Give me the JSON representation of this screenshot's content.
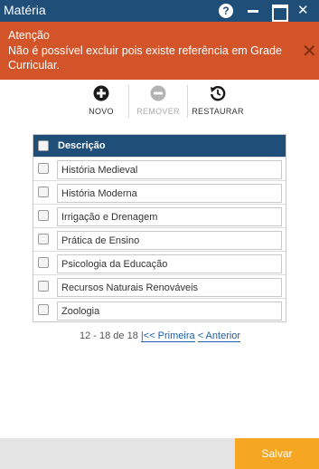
{
  "window": {
    "title": "Matéria"
  },
  "alert": {
    "heading": "Atenção",
    "message": "Não é possível excluir pois existe referência em Grade Curricular.",
    "close": "✕"
  },
  "toolbar": {
    "new_label": "NOVO",
    "remove_label": "REMOVER",
    "restore_label": "RESTAURAR"
  },
  "table": {
    "header": "Descrição",
    "rows": [
      "História Medieval",
      "História Moderna",
      "Irrigação e Drenagem",
      "Prática de Ensino",
      "Psicologia da Educação",
      "Recursos Naturais Renováveis",
      "Zoologia"
    ]
  },
  "pager": {
    "range": "12 - 18 de 18",
    "first": "|<< Primeira",
    "previous": "< Anterior"
  },
  "footer": {
    "save_label": "Salvar"
  },
  "colors": {
    "titlebar": "#1f4e79",
    "alert": "#d35428",
    "save": "#f5a623"
  },
  "icons": [
    "help-icon",
    "minimize-icon",
    "maximize-icon",
    "close-icon",
    "add-icon",
    "remove-icon",
    "restore-icon"
  ]
}
